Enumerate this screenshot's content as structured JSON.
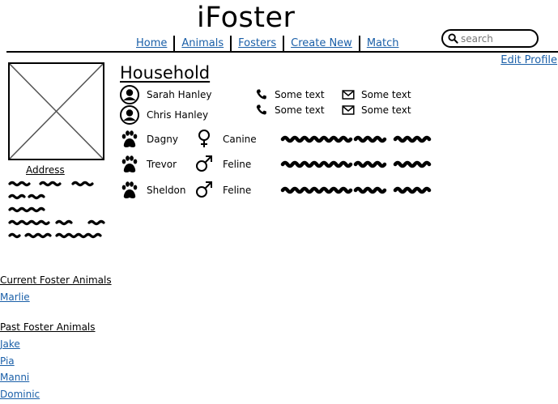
{
  "app": {
    "title": "iFoster"
  },
  "nav": {
    "items": [
      "Home",
      "Animals",
      "Fosters",
      "Create New",
      "Match"
    ]
  },
  "search": {
    "placeholder": "search"
  },
  "profile": {
    "edit_label": "Edit Profile",
    "address_label": "Address"
  },
  "household": {
    "title": "Household",
    "members": [
      {
        "name": "Sarah Hanley",
        "phone": "Some text",
        "email": "Some text"
      },
      {
        "name": "Chris Hanley",
        "phone": "Some text",
        "email": "Some text"
      }
    ],
    "pets": [
      {
        "name": "Dagny",
        "gender_icon": "female-icon",
        "species": "Canine"
      },
      {
        "name": "Trevor",
        "gender_icon": "male-icon",
        "species": "Feline"
      },
      {
        "name": "Sheldon",
        "gender_icon": "male-icon",
        "species": "Feline"
      }
    ]
  },
  "current_fosters": {
    "heading": "Current Foster Animals",
    "animals": [
      "Marlie"
    ]
  },
  "past_fosters": {
    "heading": "Past Foster Animals",
    "animals": [
      "Jake",
      "Pia",
      "Manni",
      "Dominic"
    ]
  },
  "colors": {
    "link": "#1a5fa8",
    "text": "#000000"
  }
}
